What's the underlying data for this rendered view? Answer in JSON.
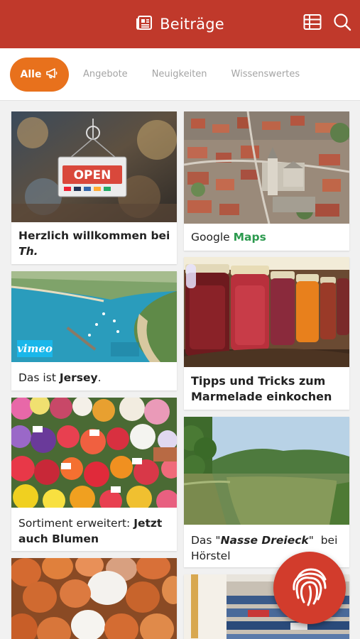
{
  "header": {
    "title": "Beiträge",
    "icon": "newspaper-icon",
    "actions": [
      "table-icon",
      "search-icon"
    ]
  },
  "filters": {
    "active": "Alle",
    "active_icon": "megaphone-icon",
    "tabs": [
      "Angebote",
      "Neuigkeiten",
      "Wissenswertes"
    ]
  },
  "cards": {
    "welcome": {
      "text": "Herzlich willkommen bei ",
      "italic": "Th."
    },
    "maps": {
      "text": "Google ",
      "highlight": "Maps"
    },
    "jersey": {
      "text": "Das ist ",
      "bold": "Jersey",
      "after": ".",
      "badge": "vimeo"
    },
    "jam": {
      "line1": "Tipps und Tricks zum",
      "line2": "Marmelade einkochen"
    },
    "flowers": {
      "text": "Sortiment erweitert: ",
      "bold": "Jetzt auch Blumen"
    },
    "lake": {
      "before": "Das \"",
      "italic": "Nasse Dreieck",
      "after": "\"  bei",
      "line2": "Hörstel"
    }
  },
  "colors": {
    "header": "#c0392b",
    "accent": "#e8711c",
    "maps_green": "#2b9a4e",
    "fab": "#d23c2c"
  },
  "fab_icon": "fingerprint-icon"
}
